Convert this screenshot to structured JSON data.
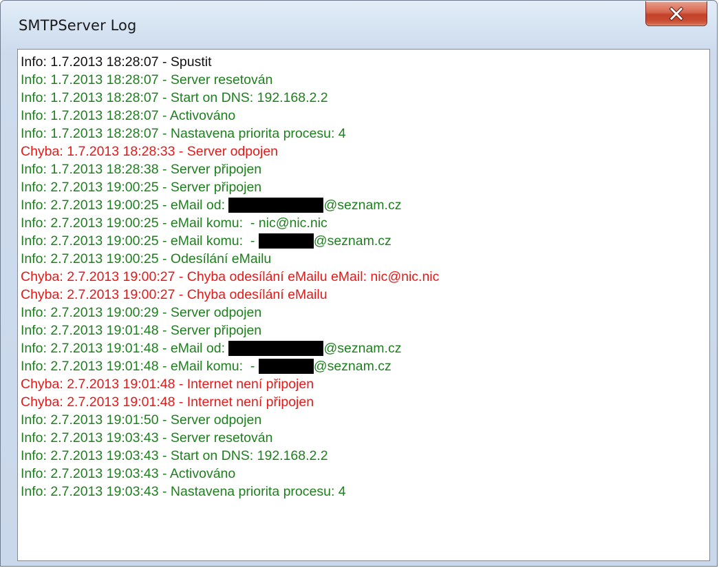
{
  "window": {
    "title": "SMTPServer Log",
    "close_glyph": "close-icon"
  },
  "colors": {
    "info": "#1e7f1e",
    "info_first": "#111111",
    "error": "#e21a1a",
    "redaction": "#000000"
  },
  "log": [
    {
      "type": "info",
      "neutral": true,
      "text": "Info: 1.7.2013 18:28:07 - Spustit"
    },
    {
      "type": "info",
      "text": "Info: 1.7.2013 18:28:07 - Server resetován"
    },
    {
      "type": "info",
      "text": "Info: 1.7.2013 18:28:07 - Start on DNS: 192.168.2.2"
    },
    {
      "type": "info",
      "text": "Info: 1.7.2013 18:28:07 - Activováno"
    },
    {
      "type": "info",
      "text": "Info: 1.7.2013 18:28:07 - Nastavena priorita procesu: 4"
    },
    {
      "type": "error",
      "text": "Chyba: 1.7.2013 18:28:33 - Server odpojen"
    },
    {
      "type": "info",
      "text": "Info: 1.7.2013 18:28:38 - Server připojen"
    },
    {
      "type": "info",
      "text": "Info: 2.7.2013 19:00:25 - Server připojen"
    },
    {
      "type": "info",
      "text": "Info: 2.7.2013 19:00:25 - eMail od: ",
      "redacted": "long",
      "suffix": "@seznam.cz"
    },
    {
      "type": "info",
      "text": "Info: 2.7.2013 19:00:25 - eMail komu:  - nic@nic.nic"
    },
    {
      "type": "info",
      "text": "Info: 2.7.2013 19:00:25 - eMail komu:  - ",
      "redacted": "short",
      "suffix": "@seznam.cz"
    },
    {
      "type": "info",
      "text": "Info: 2.7.2013 19:00:25 - Odesílání eMailu"
    },
    {
      "type": "error",
      "text": "Chyba: 2.7.2013 19:00:27 - Chyba odesílání eMailu eMail: nic@nic.nic"
    },
    {
      "type": "error",
      "text": "Chyba: 2.7.2013 19:00:27 - Chyba odesílání eMailu"
    },
    {
      "type": "info",
      "text": "Info: 2.7.2013 19:00:29 - Server odpojen"
    },
    {
      "type": "info",
      "text": "Info: 2.7.2013 19:01:48 - Server připojen"
    },
    {
      "type": "info",
      "text": "Info: 2.7.2013 19:01:48 - eMail od: ",
      "redacted": "long",
      "suffix": "@seznam.cz"
    },
    {
      "type": "info",
      "text": "Info: 2.7.2013 19:01:48 - eMail komu:  - ",
      "redacted": "short",
      "suffix": "@seznam.cz"
    },
    {
      "type": "error",
      "text": "Chyba: 2.7.2013 19:01:48 - Internet není připojen"
    },
    {
      "type": "error",
      "text": "Chyba: 2.7.2013 19:01:48 - Internet není připojen"
    },
    {
      "type": "info",
      "text": "Info: 2.7.2013 19:01:50 - Server odpojen"
    },
    {
      "type": "info",
      "text": "Info: 2.7.2013 19:03:43 - Server resetován"
    },
    {
      "type": "info",
      "text": "Info: 2.7.2013 19:03:43 - Start on DNS: 192.168.2.2"
    },
    {
      "type": "info",
      "text": "Info: 2.7.2013 19:03:43 - Activováno"
    },
    {
      "type": "info",
      "text": "Info: 2.7.2013 19:03:43 - Nastavena priorita procesu: 4"
    }
  ]
}
